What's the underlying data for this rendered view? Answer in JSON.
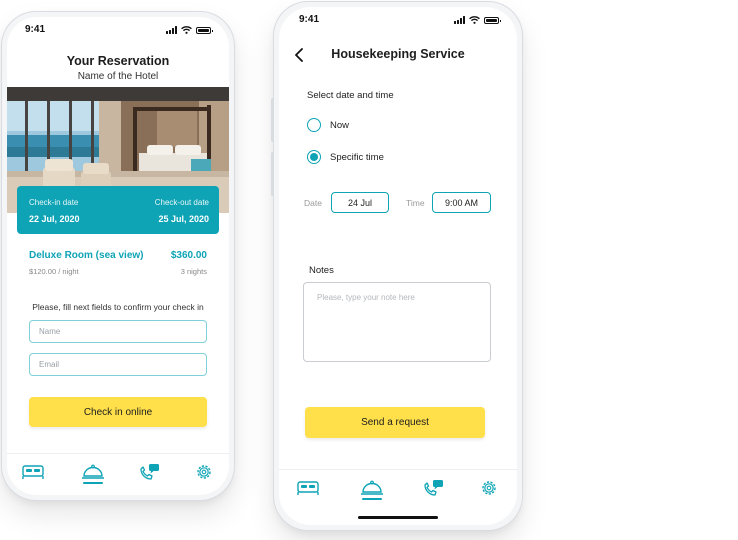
{
  "colors": {
    "accent": "#0ea4b5",
    "cta": "#ffdf4a",
    "text": "#222222",
    "muted": "#888888"
  },
  "left_screen": {
    "status_time": "9:41",
    "header": {
      "title": "Your Reservation",
      "subtitle": "Name of the Hotel"
    },
    "dates": {
      "checkin_label": "Check-in date",
      "checkin_value": "22 Jul, 2020",
      "checkout_label": "Check-out date",
      "checkout_value": "25 Jul, 2020"
    },
    "room": {
      "name": "Deluxe Room (sea view)",
      "total": "$360.00",
      "per_night": "$120.00 / night",
      "nights": "3 nights"
    },
    "form": {
      "note": "Please, fill next fields to confirm your check in",
      "name_placeholder": "Name",
      "email_placeholder": "Email",
      "submit_label": "Check in online"
    },
    "tabbar": {
      "active": "room-service",
      "icons": [
        "bed-icon",
        "room-service-icon",
        "phone-chat-icon",
        "gear-icon"
      ]
    }
  },
  "right_screen": {
    "status_time": "9:41",
    "header": {
      "title": "Housekeeping Service"
    },
    "schedule": {
      "label": "Select date and time",
      "options": [
        "Now",
        "Specific time"
      ],
      "selected": "Specific time",
      "date_label": "Date",
      "date_value": "24 Jul",
      "time_label": "Time",
      "time_value": "9:00 AM"
    },
    "notes": {
      "label": "Notes",
      "placeholder": "Please, type your note here"
    },
    "submit_label": "Send a request",
    "tabbar": {
      "active": "room-service",
      "icons": [
        "bed-icon",
        "room-service-icon",
        "phone-chat-icon",
        "gear-icon"
      ]
    }
  }
}
